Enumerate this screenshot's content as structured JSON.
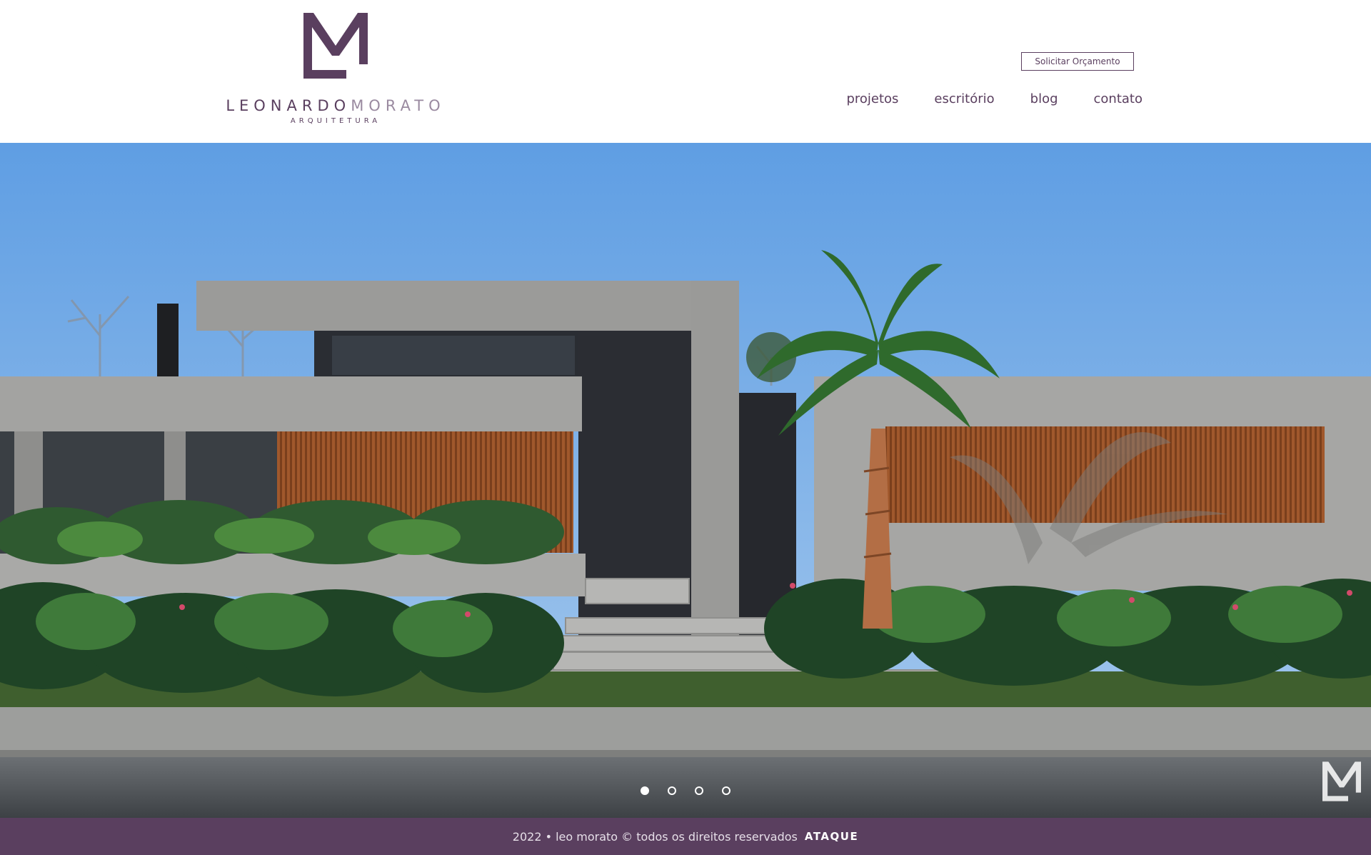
{
  "header": {
    "logo": {
      "name_first": "LEONARDO",
      "name_last": "MORATO",
      "subtitle": "ARQUITETURA",
      "mark_icon": "lm-monogram-icon"
    },
    "quote_button": "Solicitar Orçamento",
    "nav": [
      "projetos",
      "escritório",
      "blog",
      "contato"
    ]
  },
  "hero": {
    "image_description_icon": "modern-house-render",
    "slides_count": 4,
    "active_slide": 1,
    "watermark_icon": "lm-monogram-icon"
  },
  "footer": {
    "text": "2022 • leo morato © todos os direitos reservados",
    "brand": "ATAQUE"
  },
  "colors": {
    "brand": "#5a3f5f",
    "footer_bg": "#5a3f5f",
    "sky": "#6fa8e0"
  }
}
